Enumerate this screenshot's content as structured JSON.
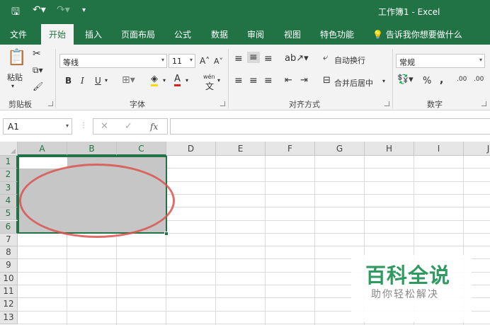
{
  "titlebar": {
    "title": "工作簿1 - Excel",
    "save_icon": "save-icon",
    "undo_icon": "undo-icon",
    "redo_icon": "redo-icon",
    "customize_icon": "customize-qat-icon"
  },
  "tabs": [
    "文件",
    "开始",
    "插入",
    "页面布局",
    "公式",
    "数据",
    "审阅",
    "视图",
    "特色功能"
  ],
  "tell_me": "告诉我你想要做什么",
  "ribbon": {
    "clipboard": {
      "label": "剪贴板",
      "paste": "粘贴"
    },
    "font": {
      "label": "字体",
      "name": "等线",
      "size": "11",
      "bold": "B",
      "italic": "I",
      "underline": "U",
      "grow": "A˄",
      "shrink": "A˅",
      "wen": "wén"
    },
    "alignment": {
      "label": "对齐方式",
      "wrap": "自动换行",
      "merge": "合并后居中"
    },
    "number": {
      "label": "数字",
      "format": "常规",
      "percent": "%",
      "comma": ",",
      "inc_dec": ".00",
      "dec_dec": ".00"
    }
  },
  "formula_bar": {
    "name_box": "A1",
    "cancel": "✕",
    "enter": "✓",
    "fx": "fx",
    "value": ""
  },
  "grid": {
    "columns": [
      "A",
      "B",
      "C",
      "D",
      "E",
      "F",
      "G",
      "H",
      "I",
      "J"
    ],
    "rows": [
      "1",
      "2",
      "3",
      "4",
      "5",
      "6",
      "7",
      "8",
      "9",
      "10",
      "11",
      "12",
      "13"
    ],
    "selection": "A1:C6"
  },
  "watermark": {
    "title": "百科全说",
    "subtitle": "助你轻松解决"
  },
  "colors": {
    "accent": "#217346",
    "selection": "#c6c6c6",
    "annotation": "#d9534f"
  }
}
